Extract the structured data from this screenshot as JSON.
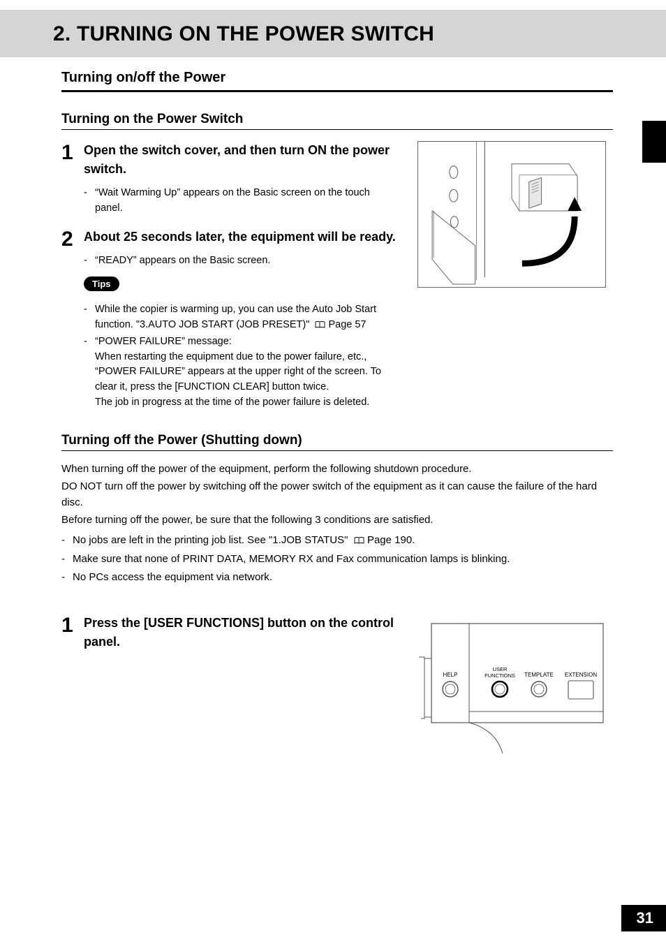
{
  "title": "2. TURNING ON THE POWER SWITCH",
  "section_a": "Turning on/off the Power",
  "section_b": "Turning on the Power Switch",
  "section_c": "Turning off the Power (Shutting down)",
  "steps_on": {
    "s1": {
      "num": "1",
      "title": "Open the switch cover, and then turn ON the power switch.",
      "bullets": [
        "“Wait Warming Up” appears on the Basic screen on the touch panel."
      ]
    },
    "s2": {
      "num": "2",
      "title": "About 25 seconds later, the equipment will be ready.",
      "bullets": [
        "“READY” appears on the Basic screen."
      ],
      "tips_label": "Tips",
      "tips": {
        "t1_a": "While the copier is warming up, you can use the Auto Job Start function. \"3.AUTO JOB START (JOB PRESET)\"",
        "t1_pageref": "Page 57",
        "t2_head": "“POWER FAILURE” message:",
        "t2_body1": "When restarting the equipment due to the power failure, etc., “POWER FAILURE” appears at the upper right of the screen. To clear it, press the [FUNCTION CLEAR] button twice.",
        "t2_body2": "The job in progress at the time of the power failure is deleted."
      }
    }
  },
  "shutdown_intro": {
    "p1": "When turning off the power of the equipment, perform the following shutdown procedure.",
    "p2": "DO NOT turn off the power by switching off the power switch of the equipment as it can cause the failure of the hard disc.",
    "p3": "Before turning off the power, be sure that the following 3 conditions are satisfied."
  },
  "shutdown_conditions": {
    "c1_a": "No jobs are left in the printing job list. See \"1.JOB STATUS\"",
    "c1_pageref": "Page 190.",
    "c2": "Make sure that none of PRINT DATA, MEMORY RX and Fax communication lamps is blinking.",
    "c3": "No PCs access the equipment via network."
  },
  "steps_off": {
    "s1": {
      "num": "1",
      "title": "Press the [USER FUNCTIONS] button on the control panel."
    }
  },
  "panel_labels": {
    "help": "HELP",
    "user_functions": "USER\nFUNCTIONS",
    "template": "TEMPLATE",
    "extension": "EXTENSION"
  },
  "page_number": "31"
}
